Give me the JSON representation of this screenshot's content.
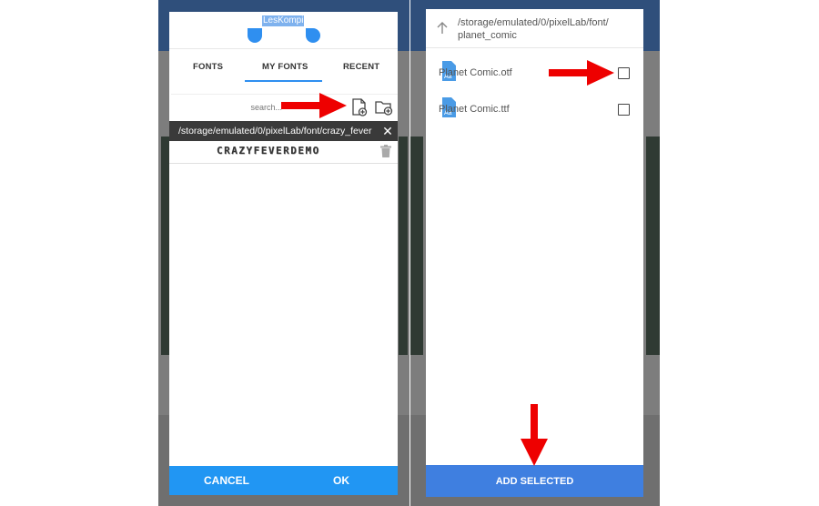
{
  "left_dialog": {
    "logo_text": "LesKompi",
    "tabs": [
      {
        "label": "FONTS"
      },
      {
        "label": "MY FONTS"
      },
      {
        "label": "RECENT"
      }
    ],
    "search": {
      "placeholder": "search..."
    },
    "path": "/storage/emulated/0/pixelLab/font/crazy_fever",
    "font_preview": "CRAZYFEVERDEMO",
    "buttons": {
      "cancel": "CANCEL",
      "ok": "OK"
    }
  },
  "right_dialog": {
    "path_line1": "/storage/emulated/0/pixelLab/font/",
    "path_line2": "planet_comic",
    "files": [
      {
        "name": "Planet Comic.otf",
        "icon_text": "Aa"
      },
      {
        "name": "Planet Comic.ttf",
        "icon_text": "Aa"
      }
    ],
    "add_button": "ADD SELECTED"
  },
  "colors": {
    "accent_blue": "#2196f3",
    "add_blue": "#3f7fe0",
    "arrow_red": "#ee0000",
    "path_bar": "#3a3a3a"
  },
  "icons": [
    "add-file-icon",
    "add-folder-icon",
    "close-icon",
    "trash-icon",
    "up-arrow-icon",
    "font-file-icon",
    "red-arrow"
  ]
}
